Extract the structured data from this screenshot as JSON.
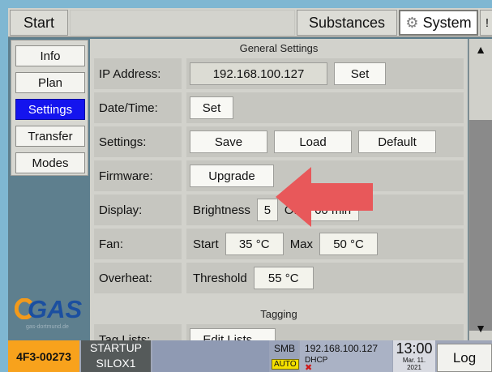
{
  "topbar": {
    "start_label": "Start",
    "substances_label": "Substances",
    "system_label": "System",
    "more_label": "!"
  },
  "sidemenu": {
    "items": [
      {
        "label": "Info",
        "active": false
      },
      {
        "label": "Plan",
        "active": false
      },
      {
        "label": "Settings",
        "active": true
      },
      {
        "label": "Transfer",
        "active": false
      },
      {
        "label": "Modes",
        "active": false
      }
    ]
  },
  "logo": {
    "text": "GAS",
    "url": "gas-dortmund.de"
  },
  "general": {
    "title": "General Settings",
    "ip_label": "IP Address:",
    "ip_value": "192.168.100.127",
    "ip_set": "Set",
    "datetime_label": "Date/Time:",
    "datetime_set": "Set",
    "settings_label": "Settings:",
    "save": "Save",
    "load": "Load",
    "default": "Default",
    "firmware_label": "Firmware:",
    "upgrade": "Upgrade",
    "display_label": "Display:",
    "brightness_label": "Brightness",
    "brightness_value": "5",
    "off_label": "Off",
    "off_value": "60 min",
    "fan_label": "Fan:",
    "fan_start_label": "Start",
    "fan_start_value": "35 °C",
    "fan_max_label": "Max",
    "fan_max_value": "50 °C",
    "overheat_label": "Overheat:",
    "threshold_label": "Threshold",
    "threshold_value": "55 °C"
  },
  "tagging": {
    "title": "Tagging",
    "taglists_label": "Tag Lists:",
    "edit_lists": "Edit Lists..."
  },
  "status": {
    "device_id": "4F3-00273",
    "state_line1": "STARTUP",
    "state_line2": "SILOX1",
    "smb": "SMB",
    "auto": "AUTO",
    "ip": "192.168.100.127",
    "dhcp": "DHCP",
    "time": "13:00",
    "date_line1": "Mar. 11.",
    "date_line2": "2021",
    "log_label": "Log"
  },
  "colors": {
    "active_menu": "#1414ee",
    "device_badge": "#f8a21c",
    "arrow": "#e8585a",
    "auto_badge": "#f4e000"
  }
}
